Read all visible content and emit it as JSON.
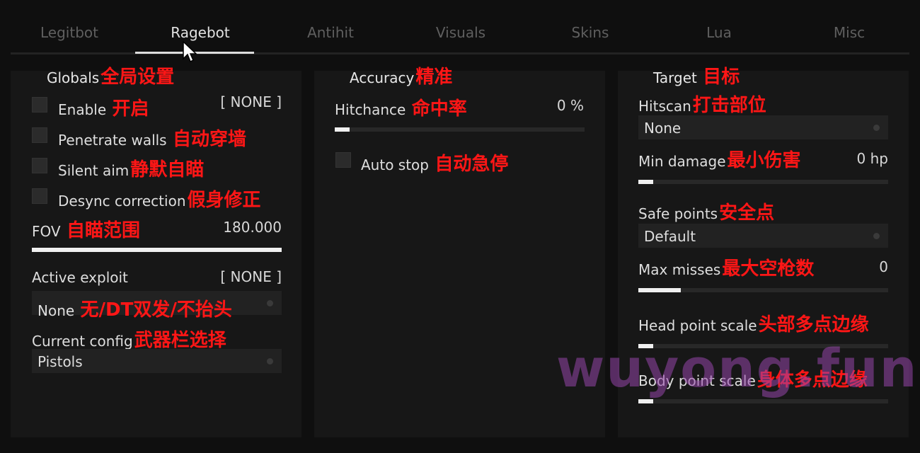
{
  "tabs": [
    {
      "label": "Legitbot"
    },
    {
      "label": "Ragebot"
    },
    {
      "label": "Antihit"
    },
    {
      "label": "Visuals"
    },
    {
      "label": "Skins"
    },
    {
      "label": "Lua"
    },
    {
      "label": "Misc"
    }
  ],
  "active_tab": "Ragebot",
  "globals": {
    "title": "Globals",
    "title_cn": "全局设置",
    "enable": {
      "label": "Enable",
      "cn": "开启",
      "key": "[ NONE ]",
      "checked": false
    },
    "penetrate_walls": {
      "label": "Penetrate walls",
      "cn": "自动穿墙",
      "checked": false
    },
    "silent_aim": {
      "label": "Silent aim",
      "cn": "静默自瞄",
      "checked": false
    },
    "desync_correction": {
      "label": "Desync correction",
      "cn": "假身修正",
      "checked": false
    },
    "fov": {
      "label": "FOV",
      "cn": "自瞄范围",
      "value": "180.000",
      "fill": 1.0
    },
    "active_exploit": {
      "label": "Active exploit",
      "key": "[ NONE ]",
      "selected": "None",
      "cn": "无/DT双发/不抬头"
    },
    "current_config": {
      "label": "Current config",
      "cn": "武器栏选择",
      "selected": "Pistols"
    }
  },
  "accuracy": {
    "title": "Accuracy",
    "title_cn": "精准",
    "hitchance": {
      "label": "Hitchance",
      "cn": "命中率",
      "value": "0 %",
      "fill": 0.06
    },
    "auto_stop": {
      "label": "Auto stop",
      "cn": "自动急停",
      "checked": false
    }
  },
  "target": {
    "title": "Target",
    "title_cn": "目标",
    "hitscan": {
      "label": "Hitscan",
      "cn": "打击部位",
      "selected": "None"
    },
    "min_damage": {
      "label": "Min damage",
      "cn": "最小伤害",
      "value": "0 hp",
      "fill": 0.06
    },
    "safe_points": {
      "label": "Safe points",
      "cn": "安全点",
      "selected": "Default"
    },
    "max_misses": {
      "label": "Max misses",
      "cn": "最大空枪数",
      "value": "0",
      "fill": 0.17
    },
    "head_point_scale": {
      "label": "Head point scale",
      "cn": "头部多点边缘",
      "fill": 0.06
    },
    "body_point_scale": {
      "label": "Body point scale",
      "cn": "身体多点边缘",
      "fill": 0.06
    }
  },
  "watermark": "wuyong.fun",
  "colors": {
    "accent": "#ff1616",
    "background": "#0f0f0f",
    "panel": "#171717",
    "watermark": "#9646aa"
  }
}
